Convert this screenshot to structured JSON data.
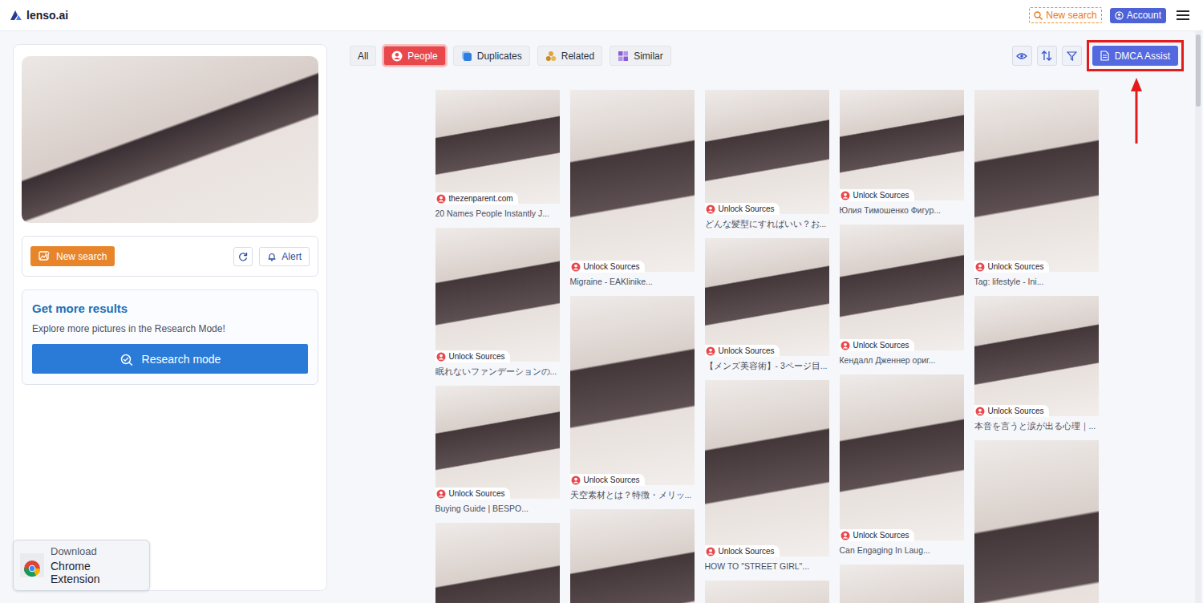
{
  "header": {
    "logo": "lenso.ai",
    "new_search": "New search",
    "account": "Account"
  },
  "sidebar": {
    "new_search": "New search",
    "alert": "Alert",
    "promo": {
      "title": "Get more results",
      "text": "Explore more pictures in the Research Mode!",
      "button": "Research mode"
    },
    "extension": {
      "line1": "Download",
      "line2": "Chrome Extension"
    }
  },
  "filters": [
    {
      "label": "All",
      "selected": false
    },
    {
      "label": "People",
      "selected": true
    },
    {
      "label": "Duplicates",
      "selected": false
    },
    {
      "label": "Related",
      "selected": false
    },
    {
      "label": "Similar",
      "selected": false
    }
  ],
  "dmca": {
    "label": "DMCA Assist",
    "highlighted": true
  },
  "results": {
    "columns": [
      [
        {
          "kind": "full",
          "source": "thezenparent.com",
          "caption": "20 Names People Instantly J..."
        },
        {
          "kind": "full",
          "source": "Unlock Sources",
          "caption": "眠れないファンデーションの..."
        },
        {
          "kind": "full",
          "source": "Unlock Sources",
          "caption": "Buying Guide | BESPO..."
        },
        {
          "kind": "partial"
        }
      ],
      [
        {
          "kind": "full",
          "source": "Unlock Sources",
          "caption": "Migraine - EAKlinike..."
        },
        {
          "kind": "full",
          "source": "Unlock Sources",
          "caption": "天空素材とは？特徴・メリッ..."
        },
        {
          "kind": "partial"
        }
      ],
      [
        {
          "kind": "full",
          "source": "Unlock Sources",
          "caption": "どんな髪型にすればいい？お..."
        },
        {
          "kind": "full",
          "source": "Unlock Sources",
          "caption": "【メンズ美容術】- 3ページ目..."
        },
        {
          "kind": "full",
          "source": "Unlock Sources",
          "caption": "HOW TO \"STREET GIRL\"..."
        },
        {
          "kind": "partial"
        }
      ],
      [
        {
          "kind": "full",
          "source": "Unlock Sources",
          "caption": "Юлия Тимошенко Фигур..."
        },
        {
          "kind": "full",
          "source": "Unlock Sources",
          "caption": "Кендалл Дженнер ориг..."
        },
        {
          "kind": "full",
          "source": "Unlock Sources",
          "caption": "Can Engaging In Laug..."
        },
        {
          "kind": "partial"
        }
      ],
      [
        {
          "kind": "full",
          "source": "Unlock Sources",
          "caption": "Tag: lifestyle - Ini..."
        },
        {
          "kind": "full",
          "source": "Unlock Sources",
          "caption": "本音を言うと涙が出る心理｜..."
        },
        {
          "kind": "partial"
        }
      ]
    ]
  }
}
